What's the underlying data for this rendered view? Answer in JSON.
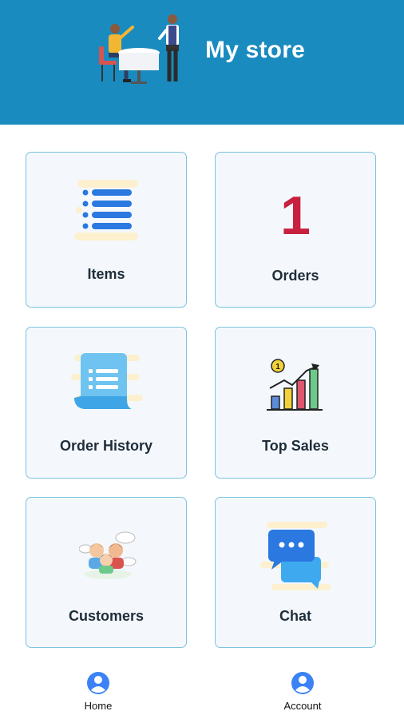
{
  "header": {
    "title": "My store"
  },
  "tiles": {
    "items": {
      "label": "Items"
    },
    "orders": {
      "label": "Orders",
      "count": "1"
    },
    "order_history": {
      "label": "Order History"
    },
    "top_sales": {
      "label": "Top Sales"
    },
    "customers": {
      "label": "Customers"
    },
    "chat": {
      "label": "Chat"
    }
  },
  "bottom_nav": {
    "home": {
      "label": "Home"
    },
    "account": {
      "label": "Account"
    }
  },
  "colors": {
    "header_bg": "#1a8bbf",
    "tile_bg": "#f4f8fc",
    "tile_border": "#7cc3e0",
    "order_count": "#c8203f",
    "nav_icon": "#3b82f6"
  },
  "icons": {
    "header": "store-clerk-illustration",
    "items": "list-icon",
    "order_history": "receipt-icon",
    "top_sales": "bar-chart-growth-icon",
    "customers": "customers-group-icon",
    "chat": "chat-bubbles-icon",
    "home": "user-circle-icon",
    "account": "user-circle-icon"
  }
}
